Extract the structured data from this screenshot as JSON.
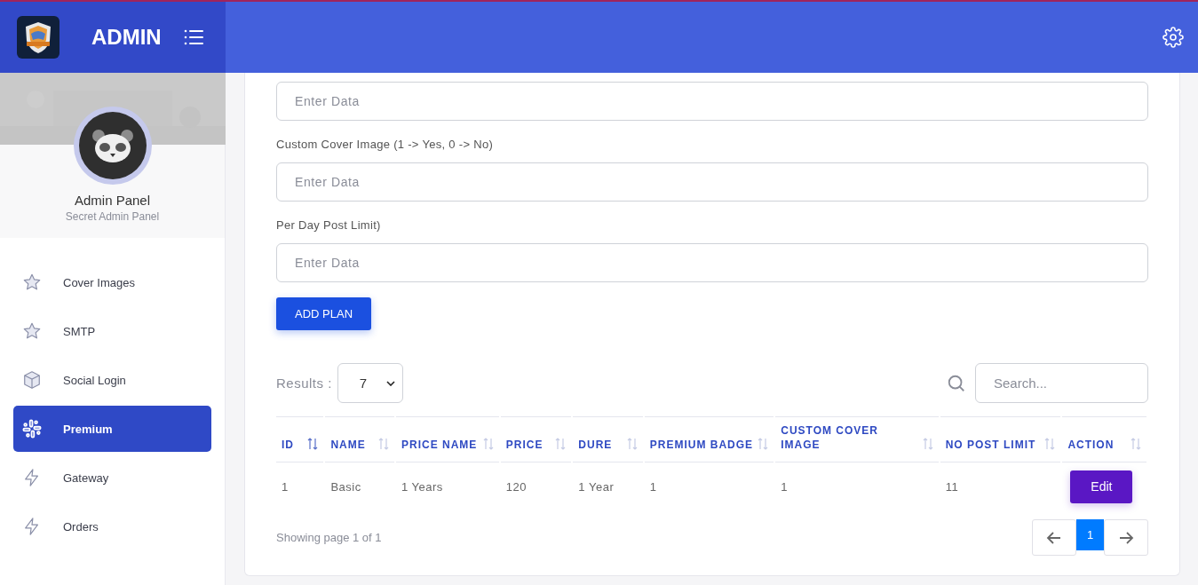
{
  "header": {
    "title": "ADMIN"
  },
  "profile": {
    "name": "Admin Panel",
    "subtitle": "Secret Admin Panel"
  },
  "sidebar": {
    "items": [
      {
        "label": "Cover Images",
        "kind": "star",
        "selected": false
      },
      {
        "label": "SMTP",
        "kind": "star",
        "selected": false
      },
      {
        "label": "Social Login",
        "kind": "box",
        "selected": false
      },
      {
        "label": "Premium",
        "kind": "grid",
        "selected": true
      },
      {
        "label": "Gateway",
        "kind": "bolt",
        "selected": false
      },
      {
        "label": "Orders",
        "kind": "bolt",
        "selected": false
      }
    ]
  },
  "form": {
    "fields": [
      {
        "placeholder": "Enter Data"
      },
      {
        "label": "Custom Cover Image (1 -> Yes, 0 -> No)",
        "placeholder": "Enter Data"
      },
      {
        "label": "Per Day Post Limit)",
        "placeholder": "Enter Data"
      }
    ],
    "submit": "ADD PLAN"
  },
  "table": {
    "results_label": "Results :",
    "page_size": "7",
    "search": {
      "placeholder": "Search..."
    },
    "columns": [
      "ID",
      "NAME",
      "PRICE NAME",
      "PRICE",
      "DURE",
      "PREMIUM BADGE",
      "CUSTOM COVER IMAGE",
      "NO POST LIMIT",
      "ACTION"
    ],
    "rows": [
      {
        "cells": [
          "1",
          "Basic",
          "1 Years",
          "120",
          "1 Year",
          "1",
          "1",
          "11"
        ],
        "action": "Edit"
      }
    ],
    "footer": "Showing page 1 of 1",
    "pages": [
      {
        "label": "1",
        "selected": true
      }
    ]
  }
}
